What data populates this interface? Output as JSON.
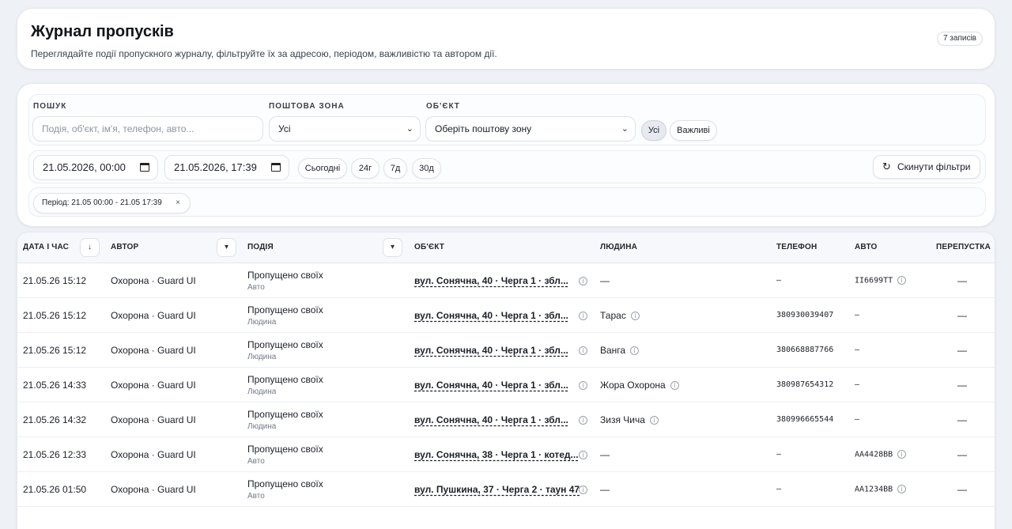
{
  "header": {
    "title": "Журнал пропусків",
    "subtitle": "Переглядайте події пропускного журналу, фільтруйте їх за адресою, періодом, важливістю та автором дії.",
    "count": "7 записів"
  },
  "filters": {
    "search_label": "ПОШУК",
    "search_placeholder": "Подія, об'єкт, ім'я, телефон, авто...",
    "zone_label": "ПОШТОВА ЗОНА",
    "zone_value": "Усі",
    "object_label": "ОБ'ЄКТ",
    "object_value": "Оберіть поштову зону",
    "importance_all": "Усі",
    "importance_important": "Важливі",
    "date_from": "21.05.2026, 00:00",
    "date_to": "21.05.2026, 17:39",
    "quick_today": "Сьогодні",
    "quick_24h": "24г",
    "quick_7d": "7д",
    "quick_30d": "30д",
    "reset_label": "Скинути фільтри",
    "period_chip": "Період: 21.05 00:00 - 21.05 17:39",
    "period_chip_close": "×"
  },
  "table": {
    "columns": {
      "datetime": "ДАТА І ЧАС",
      "author": "АВТОР",
      "event": "ПОДІЯ",
      "object": "ОБ'ЄКТ",
      "person": "ЛЮДИНА",
      "phone": "ТЕЛЕФОН",
      "car": "АВТО",
      "pass": "ПЕРЕПУСТКА"
    },
    "rows": [
      {
        "datetime": "21.05.26 15:12",
        "author": "Охорона · Guard UI",
        "event": "Пропущено своїх",
        "event_type": "Авто",
        "object": "вул. Сонячна, 40 · Черга 1 · збл...",
        "person": "—",
        "phone": "–",
        "car": "II6699TT",
        "pass": "—"
      },
      {
        "datetime": "21.05.26 15:12",
        "author": "Охорона · Guard UI",
        "event": "Пропущено своїх",
        "event_type": "Людина",
        "object": "вул. Сонячна, 40 · Черга 1 · збл...",
        "person": "Тарас",
        "phone": "380930039407",
        "car": "–",
        "pass": "—"
      },
      {
        "datetime": "21.05.26 15:12",
        "author": "Охорона · Guard UI",
        "event": "Пропущено своїх",
        "event_type": "Людина",
        "object": "вул. Сонячна, 40 · Черга 1 · збл...",
        "person": "Ванга",
        "phone": "380668887766",
        "car": "–",
        "pass": "—"
      },
      {
        "datetime": "21.05.26 14:33",
        "author": "Охорона · Guard UI",
        "event": "Пропущено своїх",
        "event_type": "Людина",
        "object": "вул. Сонячна, 40 · Черга 1 · збл...",
        "person": "Жора Охорона",
        "phone": "380987654312",
        "car": "–",
        "pass": "—"
      },
      {
        "datetime": "21.05.26 14:32",
        "author": "Охорона · Guard UI",
        "event": "Пропущено своїх",
        "event_type": "Людина",
        "object": "вул. Сонячна, 40 · Черга 1 · збл...",
        "person": "Зизя Чича",
        "phone": "380996665544",
        "car": "–",
        "pass": "—"
      },
      {
        "datetime": "21.05.26 12:33",
        "author": "Охорона · Guard UI",
        "event": "Пропущено своїх",
        "event_type": "Авто",
        "object": "вул. Сонячна, 38 · Черга 1 · котед...",
        "person": "—",
        "phone": "–",
        "car": "AA4428BB",
        "pass": "—"
      },
      {
        "datetime": "21.05.26 01:50",
        "author": "Охорона · Guard UI",
        "event": "Пропущено своїх",
        "event_type": "Авто",
        "object": "вул. Пушкина, 37 · Черга 2 · таун 47",
        "person": "—",
        "phone": "–",
        "car": "AA1234BB",
        "pass": "—"
      }
    ]
  },
  "icons": {
    "info": "info-icon",
    "reset": "reset-icon",
    "calendar": "calendar-icon",
    "chevron": "chevron-down-icon",
    "sort": "sort-arrow-icon"
  },
  "colors": {
    "background": "#eef1f6",
    "card": "#ffffff",
    "active_pill": "#e6e9ef"
  }
}
